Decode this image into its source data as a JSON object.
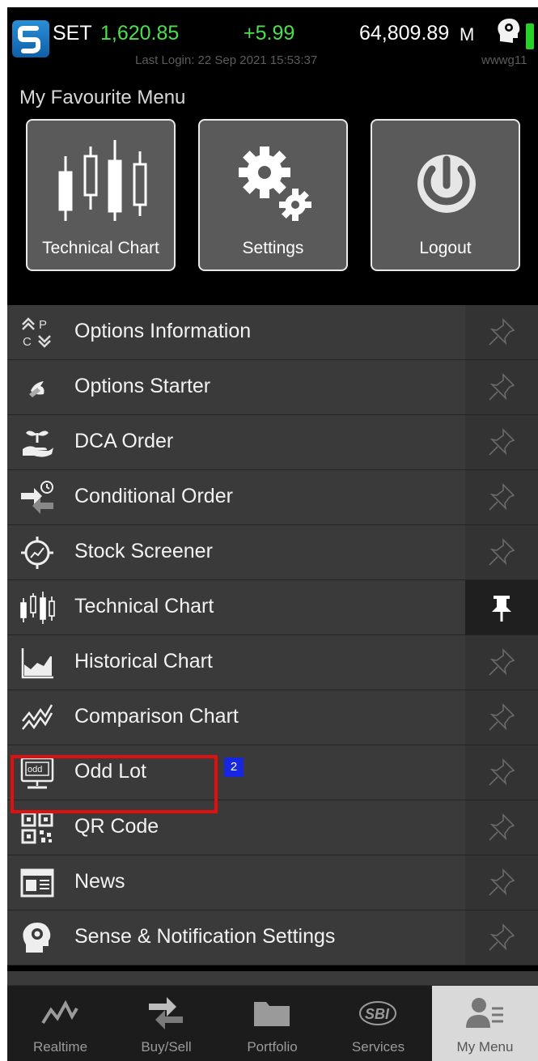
{
  "header": {
    "index_name": "SET",
    "index_value": "1,620.85",
    "index_change": "+5.99",
    "volume": "64,809.89",
    "volume_unit": "M",
    "last_login": "Last Login: 22 Sep 2021 15:53:37",
    "username": "wwwg11"
  },
  "favourite": {
    "title": "My Favourite Menu",
    "items": [
      {
        "label": "Technical Chart",
        "icon": "candlestick-icon"
      },
      {
        "label": "Settings",
        "icon": "gears-icon"
      },
      {
        "label": "Logout",
        "icon": "power-icon"
      }
    ]
  },
  "menu": {
    "items": [
      {
        "label": "Options Information",
        "icon": "options-info-icon",
        "pinned": false
      },
      {
        "label": "Options Starter",
        "icon": "options-starter-icon",
        "pinned": false
      },
      {
        "label": "DCA Order",
        "icon": "plant-hand-icon",
        "pinned": false
      },
      {
        "label": "Conditional Order",
        "icon": "conditional-order-icon",
        "pinned": false
      },
      {
        "label": "Stock Screener",
        "icon": "screener-icon",
        "pinned": false
      },
      {
        "label": "Technical Chart",
        "icon": "candlestick-icon",
        "pinned": true
      },
      {
        "label": "Historical Chart",
        "icon": "area-chart-icon",
        "pinned": false
      },
      {
        "label": "Comparison Chart",
        "icon": "comparison-chart-icon",
        "pinned": false
      },
      {
        "label": "Odd Lot",
        "icon": "odd-lot-icon",
        "pinned": false
      },
      {
        "label": "QR Code",
        "icon": "qr-code-icon",
        "pinned": false
      },
      {
        "label": "News",
        "icon": "news-icon",
        "pinned": false
      },
      {
        "label": "Sense & Notification Settings",
        "icon": "sense-head-icon",
        "pinned": false
      }
    ],
    "badge": "2"
  },
  "bottom_nav": {
    "items": [
      {
        "label": "Realtime",
        "icon": "realtime-icon",
        "active": false
      },
      {
        "label": "Buy/Sell",
        "icon": "buy-sell-icon",
        "active": false
      },
      {
        "label": "Portfolio",
        "icon": "portfolio-folder-icon",
        "active": false
      },
      {
        "label": "Services",
        "icon": "sbi-services-icon",
        "active": false
      },
      {
        "label": "My Menu",
        "icon": "my-menu-icon",
        "active": true
      }
    ]
  },
  "colors": {
    "positive": "#4be04b",
    "background": "#000000",
    "row": "#3a3a3a",
    "highlight": "#e10f0f",
    "badge": "#1726e0"
  }
}
